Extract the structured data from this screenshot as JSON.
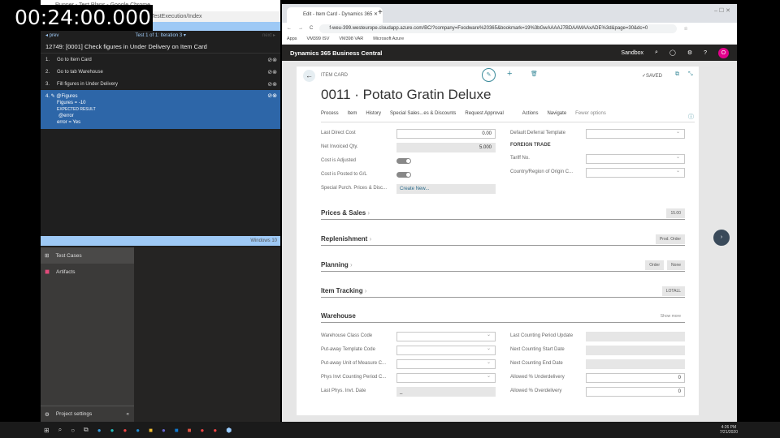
{
  "timer": "00:24:00.000",
  "left_window": {
    "title": "Runner - Test Plans - Google Chrome",
    "address": "...TestExecution/Index",
    "toolbar": "Save and Close   Create bug",
    "prev": "◂ prev",
    "iteration": "Test 1 of 1: Iteration 3 ▾",
    "next": "next ▸",
    "case_title": "12749: [0001] Check figures in Under Delivery on Item Card",
    "steps": [
      {
        "num": "1.",
        "label": "Go to Item Card"
      },
      {
        "num": "2.",
        "label": "Go to tab Warehouse"
      },
      {
        "num": "3.",
        "label": "Fill figures in Under Delivery"
      }
    ],
    "step4": {
      "num": "4.",
      "label": "@Figures",
      "param": "Figures = -10",
      "expected_label": "EXPECTED RESULT",
      "expected": "@error",
      "error": "error = Yes"
    },
    "status": "Windows 10"
  },
  "devops_sidebar": {
    "items": [
      "Test Cases",
      "Artifacts"
    ],
    "settings": "Project settings"
  },
  "browser": {
    "tab": "Edit - Item Card - Dynamics 365",
    "url": "f-weu-399.westeurope.cloudapp.azure.com/BC/?company=Foodware%20365&bookmark=19%3bGwAAAAJ7BDAAMAAxADE%3d&page=30&dc=0",
    "bookmarks": [
      "Apps",
      "VM399 ISV",
      "VM398 VAR",
      "Microsoft Azure"
    ]
  },
  "bc": {
    "app": "Dynamics 365 Business Central",
    "env": "Sandbox",
    "avatar": "O",
    "page_type": "ITEM CARD",
    "saved": "✓SAVED",
    "title": "0011 · Potato Gratin Deluxe",
    "actions": [
      "Process",
      "Item",
      "History",
      "Special Sales...es & Discounts",
      "Request Approval",
      "Actions",
      "Navigate",
      "Fewer options"
    ],
    "left_fields": [
      {
        "label": "Last Direct Cost",
        "value": "0.00"
      },
      {
        "label": "Net Invoiced Qty.",
        "value": "5.000"
      },
      {
        "label": "Cost is Adjusted",
        "value": ""
      },
      {
        "label": "Cost is Posted to G/L",
        "value": ""
      },
      {
        "label": "Special Purch. Prices & Disc...",
        "value": "Create New..."
      }
    ],
    "right_fields": [
      {
        "label": "Default Deferral Template"
      },
      {
        "label": "FOREIGN TRADE"
      },
      {
        "label": "Tariff No."
      },
      {
        "label": "Country/Region of Origin C..."
      }
    ],
    "sections": [
      {
        "title": "Prices & Sales",
        "badges": [
          "15.00"
        ]
      },
      {
        "title": "Replenishment",
        "badges": [
          "Prod. Order"
        ]
      },
      {
        "title": "Planning",
        "badges": [
          "Order",
          "None"
        ]
      },
      {
        "title": "Item Tracking",
        "badges": [
          "LOTALL"
        ]
      },
      {
        "title": "Warehouse",
        "badges": [
          "Show more"
        ]
      }
    ],
    "wh_left": [
      {
        "label": "Warehouse Class Code",
        "value": ""
      },
      {
        "label": "Put-away Template Code",
        "value": ""
      },
      {
        "label": "Put-away Unit of Measure C...",
        "value": ""
      },
      {
        "label": "Phys Invt Counting Period C...",
        "value": ""
      },
      {
        "label": "Last Phys. Invt. Date",
        "value": "_"
      }
    ],
    "wh_right": [
      {
        "label": "Last Counting Period Update",
        "value": ""
      },
      {
        "label": "Next Counting Start Date",
        "value": ""
      },
      {
        "label": "Next Counting End Date",
        "value": ""
      },
      {
        "label": "Allowed % Underdelivery",
        "value": "0"
      },
      {
        "label": "Allowed % Overdelivery",
        "value": "0"
      }
    ]
  },
  "taskbar": {
    "time": "4:26 PM",
    "date": "7/21/2020"
  },
  "colors": {
    "accent": "#2d66a8",
    "bc_header": "#252423",
    "avatar": "#e3008c"
  }
}
